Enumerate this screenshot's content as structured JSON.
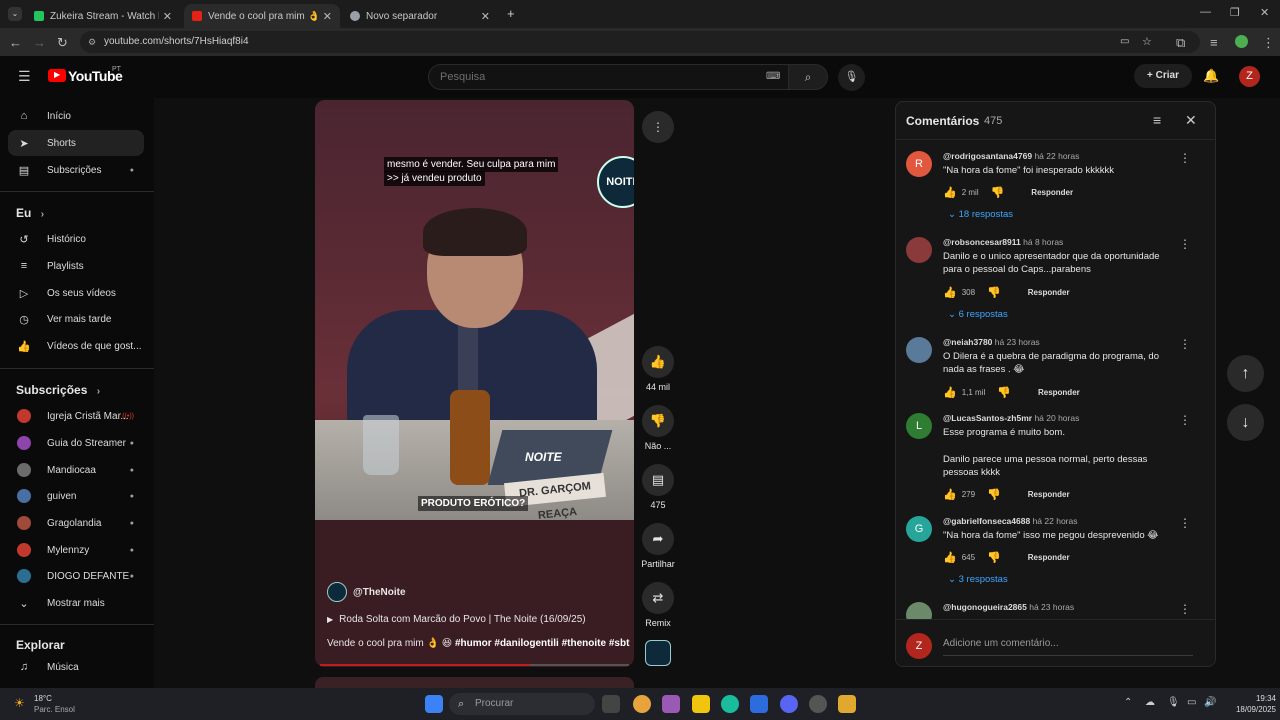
{
  "browser": {
    "tabs": [
      {
        "title": "Zukeira Stream - Watch Live on",
        "color": "#22c55e"
      },
      {
        "title": "Vende o cool pra mim 👌 🤩 🔊",
        "color": "#e62117"
      },
      {
        "title": "Novo separador",
        "color": "#9aa0a6"
      }
    ],
    "url": "youtube.com/shorts/7HsHiaqf8i4"
  },
  "header": {
    "logo": "YouTube",
    "region": "PT",
    "search_placeholder": "Pesquisa",
    "create_label": "Criar",
    "avatar_letter": "Z"
  },
  "sidebar": {
    "main": [
      {
        "label": "Início",
        "icon": "home-icon"
      },
      {
        "label": "Shorts",
        "icon": "shorts-icon"
      },
      {
        "label": "Subscrições",
        "icon": "subscriptions-icon"
      }
    ],
    "you_heading": "Eu",
    "you": [
      {
        "label": "Histórico"
      },
      {
        "label": "Playlists"
      },
      {
        "label": "Os seus vídeos"
      },
      {
        "label": "Ver mais tarde"
      },
      {
        "label": "Vídeos de que gost..."
      }
    ],
    "subs_heading": "Subscrições",
    "subs": [
      {
        "label": "Igreja Cristã Mar...",
        "color": "#c0392b"
      },
      {
        "label": "Guia do Streamer",
        "color": "#8e44ad"
      },
      {
        "label": "Mandiocaa",
        "color": "#6b6b6b"
      },
      {
        "label": "guiven",
        "color": "#4a6fa5"
      },
      {
        "label": "Gragolandia",
        "color": "#a04a3a"
      },
      {
        "label": "Mylennzy",
        "color": "#c0392b"
      },
      {
        "label": "DIOGO DEFANTE",
        "color": "#2c6e91"
      }
    ],
    "show_more": "Mostrar mais",
    "explore_heading": "Explorar",
    "explore": [
      {
        "label": "Música"
      }
    ]
  },
  "video": {
    "caption_top_1": "mesmo é vender. Seu culpa para mim",
    "caption_top_2": ">> já vendeu produto",
    "caption_bottom": "PRODUTO ERÓTICO?",
    "desk_sign": "DR. GARÇOM REAÇA",
    "laptop_text": "NOITE",
    "logo_text": "NOITE",
    "channel": "@TheNoite",
    "playlist": "Roda Solta com Marcão do Povo | The Noite (16/09/25)",
    "description_prefix": "Vende o cool pra mim 👌 😆",
    "description_tags": "#humor #danilogentili #thenoite #sbt",
    "progress": 0.68
  },
  "actions": {
    "likes": "44 mil",
    "dislike_label": "Não ...",
    "comments": "475",
    "share": "Partilhar",
    "remix": "Remix"
  },
  "comments": {
    "title": "Comentários",
    "count": "475",
    "reply_label": "Responder",
    "items": [
      {
        "handle": "@rodrigosantana4769",
        "time": "há 22 horas",
        "text": "\"Na hora da fome\" foi inesperado kkkkkk",
        "likes": "2 mil",
        "replies": "18 respostas",
        "avatar": "R",
        "color": "#e2583e"
      },
      {
        "handle": "@robsoncesar8911",
        "time": "há 8 horas",
        "text": "Danilo e o unico apresentador que da oportunidade para o pessoal do Caps...parabens",
        "likes": "308",
        "replies": "6 respostas",
        "avatar": "",
        "color": "#8a3a3a"
      },
      {
        "handle": "@neiah3780",
        "time": "há 23 horas",
        "text": "O Dilera é a quebra de paradigma do programa, do nada as frases . 😂",
        "likes": "1,1 mil",
        "replies": "",
        "avatar": "",
        "color": "#5a7a9a"
      },
      {
        "handle": "@LucasSantos-zh5mr",
        "time": "há 20 horas",
        "text": "Esse programa é muito bom.",
        "text2": "Danilo parece uma pessoa normal, perto dessas pessoas kkkk",
        "likes": "279",
        "replies": "",
        "avatar": "L",
        "color": "#2e7d32"
      },
      {
        "handle": "@gabrielfonseca4688",
        "time": "há 22 horas",
        "text": "\"Na hora da fome\" isso me pegou desprevenido 😂",
        "likes": "645",
        "replies": "3 respostas",
        "avatar": "G",
        "color": "#26a69a"
      },
      {
        "handle": "@hugonogueira2865",
        "time": "há 23 horas",
        "text": "",
        "likes": "",
        "replies": "",
        "avatar": "",
        "color": "#6a8a6a"
      }
    ],
    "add_placeholder": "Adicione um comentário...",
    "user_letter": "Z"
  },
  "taskbar": {
    "temp": "18°C",
    "weather": "Parc. Ensol",
    "search": "Procurar",
    "time": "19:34",
    "date": "18/09/2025"
  }
}
